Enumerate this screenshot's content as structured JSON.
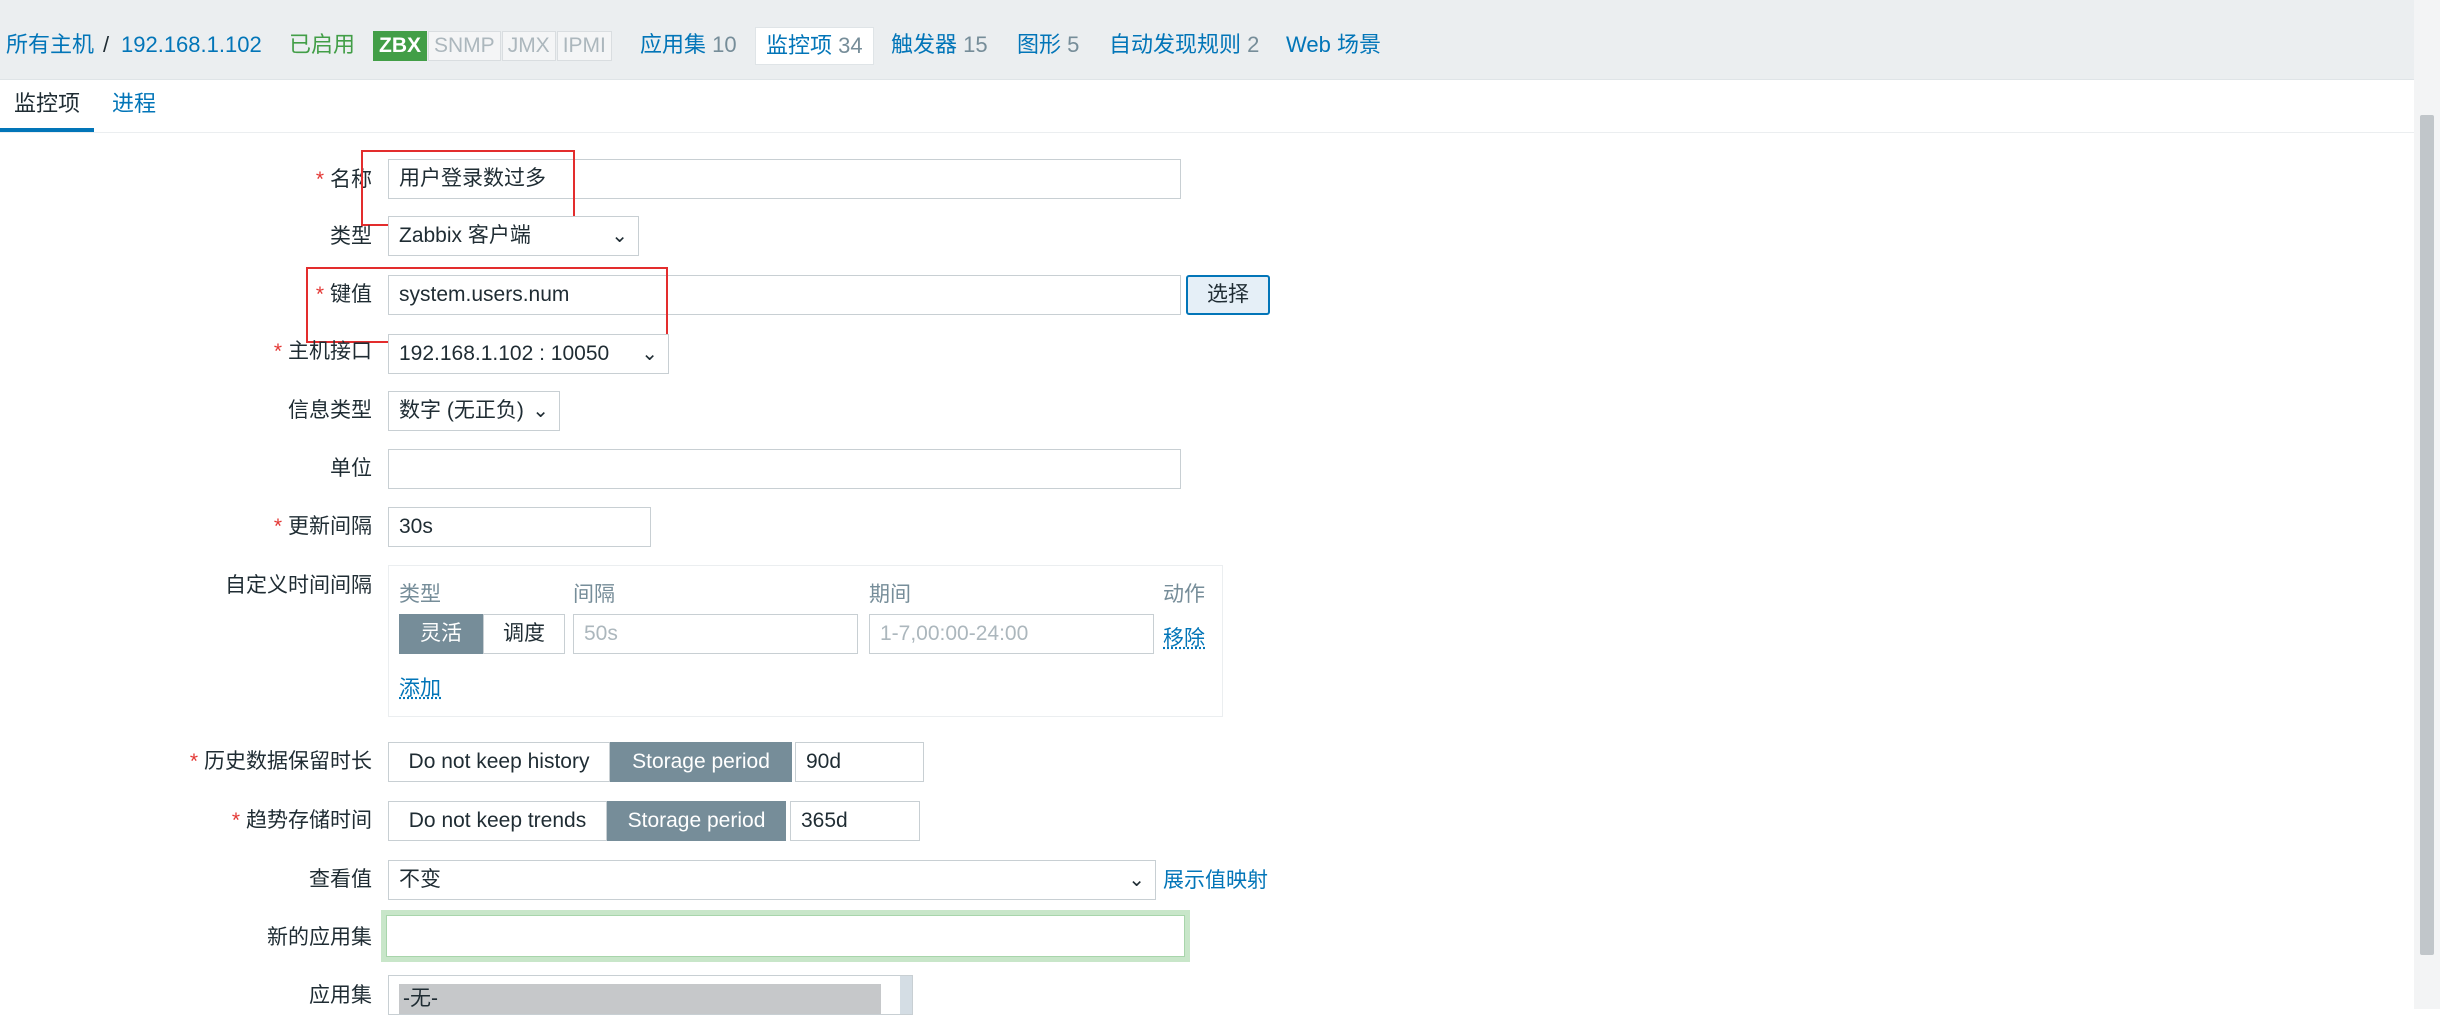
{
  "breadcrumb": {
    "all_hosts": "所有主机",
    "separator": "/",
    "host": "192.168.1.102",
    "status": "已启用"
  },
  "availability": [
    "ZBX",
    "SNMP",
    "JMX",
    "IPMI"
  ],
  "host_nav": [
    {
      "label": "应用集",
      "count": "10"
    },
    {
      "label": "监控项",
      "count": "34"
    },
    {
      "label": "触发器",
      "count": "15"
    },
    {
      "label": "图形",
      "count": "5"
    },
    {
      "label": "自动发现规则",
      "count": "2"
    },
    {
      "label": "Web 场景",
      "count": ""
    }
  ],
  "tabs": [
    "监控项",
    "进程"
  ],
  "form": {
    "name": {
      "label": "名称",
      "value": "用户登录数过多"
    },
    "type": {
      "label": "类型",
      "value": "Zabbix 客户端"
    },
    "key": {
      "label": "键值",
      "value": "system.users.num",
      "button": "选择"
    },
    "interface": {
      "label": "主机接口",
      "value": "192.168.1.102 : 10050"
    },
    "info_type": {
      "label": "信息类型",
      "value": "数字 (无正负)"
    },
    "units": {
      "label": "单位",
      "value": ""
    },
    "update_interval": {
      "label": "更新间隔",
      "value": "30s"
    },
    "custom_intervals": {
      "label": "自定义时间间隔",
      "headers": {
        "type": "类型",
        "interval": "间隔",
        "period": "期间",
        "action": "动作"
      },
      "mode_flexible": "灵活",
      "mode_scheduling": "调度",
      "interval_placeholder": "50s",
      "period_placeholder": "1-7,00:00-24:00",
      "remove": "移除",
      "add": "添加"
    },
    "history": {
      "label": "历史数据保留时长",
      "no_keep": "Do not keep history",
      "storage": "Storage period",
      "value": "90d"
    },
    "trends": {
      "label": "趋势存储时间",
      "no_keep": "Do not keep trends",
      "storage": "Storage period",
      "value": "365d"
    },
    "show_value": {
      "label": "查看值",
      "value": "不变",
      "link": "展示值映射"
    },
    "new_application": {
      "label": "新的应用集",
      "value": ""
    },
    "applications": {
      "label": "应用集",
      "option": "-无-"
    }
  },
  "colors": {
    "link": "#0275b8",
    "enabled": "#429e47",
    "required": "#e33734",
    "highlight_box": "#e32d2d",
    "segment_active": "#768d99"
  }
}
